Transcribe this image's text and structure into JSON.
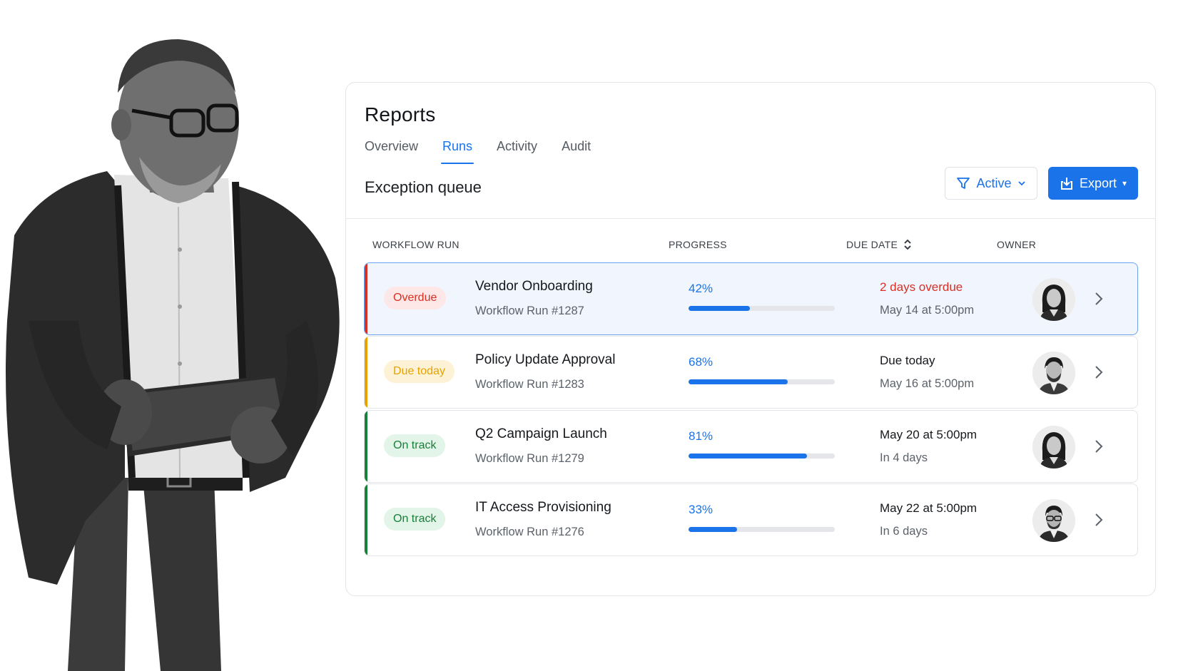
{
  "card": {
    "title": "Reports",
    "tabs": [
      {
        "label": "Overview",
        "active": false
      },
      {
        "label": "Runs",
        "active": true
      },
      {
        "label": "Activity",
        "active": false
      },
      {
        "label": "Audit",
        "active": false
      }
    ],
    "section_title": "Exception queue",
    "filter_button": {
      "label": "Active",
      "icon": "filter-icon"
    },
    "export_button": {
      "label": "Export",
      "icon": "download-icon"
    }
  },
  "table": {
    "columns": [
      "WORKFLOW RUN",
      "PROGRESS",
      "DUE DATE",
      "OWNER"
    ],
    "rows": [
      {
        "status": "Overdue",
        "name": "Vendor Onboarding",
        "run": "Workflow Run #1287",
        "progress_label": "42%",
        "progress": 0.42,
        "due_primary": "2 days overdue",
        "due_secondary": "May 14 at 5:00pm",
        "owner_icon": "avatar-woman",
        "selected": true
      },
      {
        "status": "Due today",
        "name": "Policy Update Approval",
        "run": "Workflow Run #1283",
        "progress_label": "68%",
        "progress": 0.68,
        "due_primary": "Due today",
        "due_secondary": "May 16 at 5:00pm",
        "owner_icon": "avatar-man-beard",
        "selected": false
      },
      {
        "status": "On track",
        "name": "Q2 Campaign Launch",
        "run": "Workflow Run #1279",
        "progress_label": "81%",
        "progress": 0.81,
        "due_primary": "May 20 at 5:00pm",
        "due_secondary": "In 4 days",
        "owner_icon": "avatar-woman",
        "selected": false
      },
      {
        "status": "On track",
        "name": "IT Access Provisioning",
        "run": "Workflow Run #1276",
        "progress_label": "33%",
        "progress": 0.33,
        "due_primary": "May 22 at 5:00pm",
        "due_secondary": "In 6 days",
        "owner_icon": "avatar-man-glasses",
        "selected": false
      }
    ]
  },
  "colors": {
    "accent": "#1a73e8",
    "overdue": "#d93025",
    "overdue_bg": "#fde7e7",
    "due_today": "#e8a200",
    "due_today_bg": "#fdf2d6",
    "on_track": "#188038",
    "on_track_bg": "#e3f4e8"
  }
}
